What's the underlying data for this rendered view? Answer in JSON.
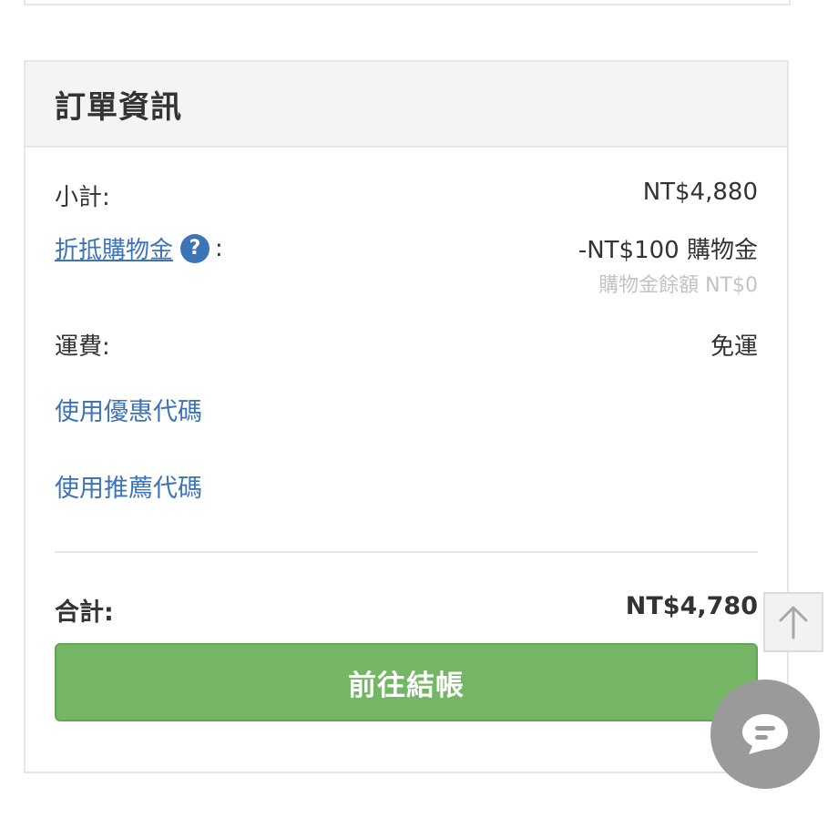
{
  "order_summary": {
    "title": "訂單資訊",
    "subtotal_label": "小計:",
    "subtotal_value": "NT$4,880",
    "credit_link": "折抵購物金",
    "credit_colon": ":",
    "credit_value": "-NT$100 購物金",
    "credit_balance": "購物金餘額 NT$0",
    "shipping_label": "運費:",
    "shipping_value": "免運",
    "coupon_link": "使用優惠代碼",
    "referral_link": "使用推薦代碼",
    "total_label": "合計:",
    "total_value": "NT$4,780",
    "checkout_label": "前往結帳"
  },
  "icons": {
    "help": "question-circle-icon",
    "scroll_top": "arrow-up-icon",
    "chat": "chat-bubble-icon"
  },
  "colors": {
    "link": "#3d73b7",
    "checkout": "#74b566",
    "muted": "#c3c3c3",
    "header_bg": "#f4f4f4"
  }
}
